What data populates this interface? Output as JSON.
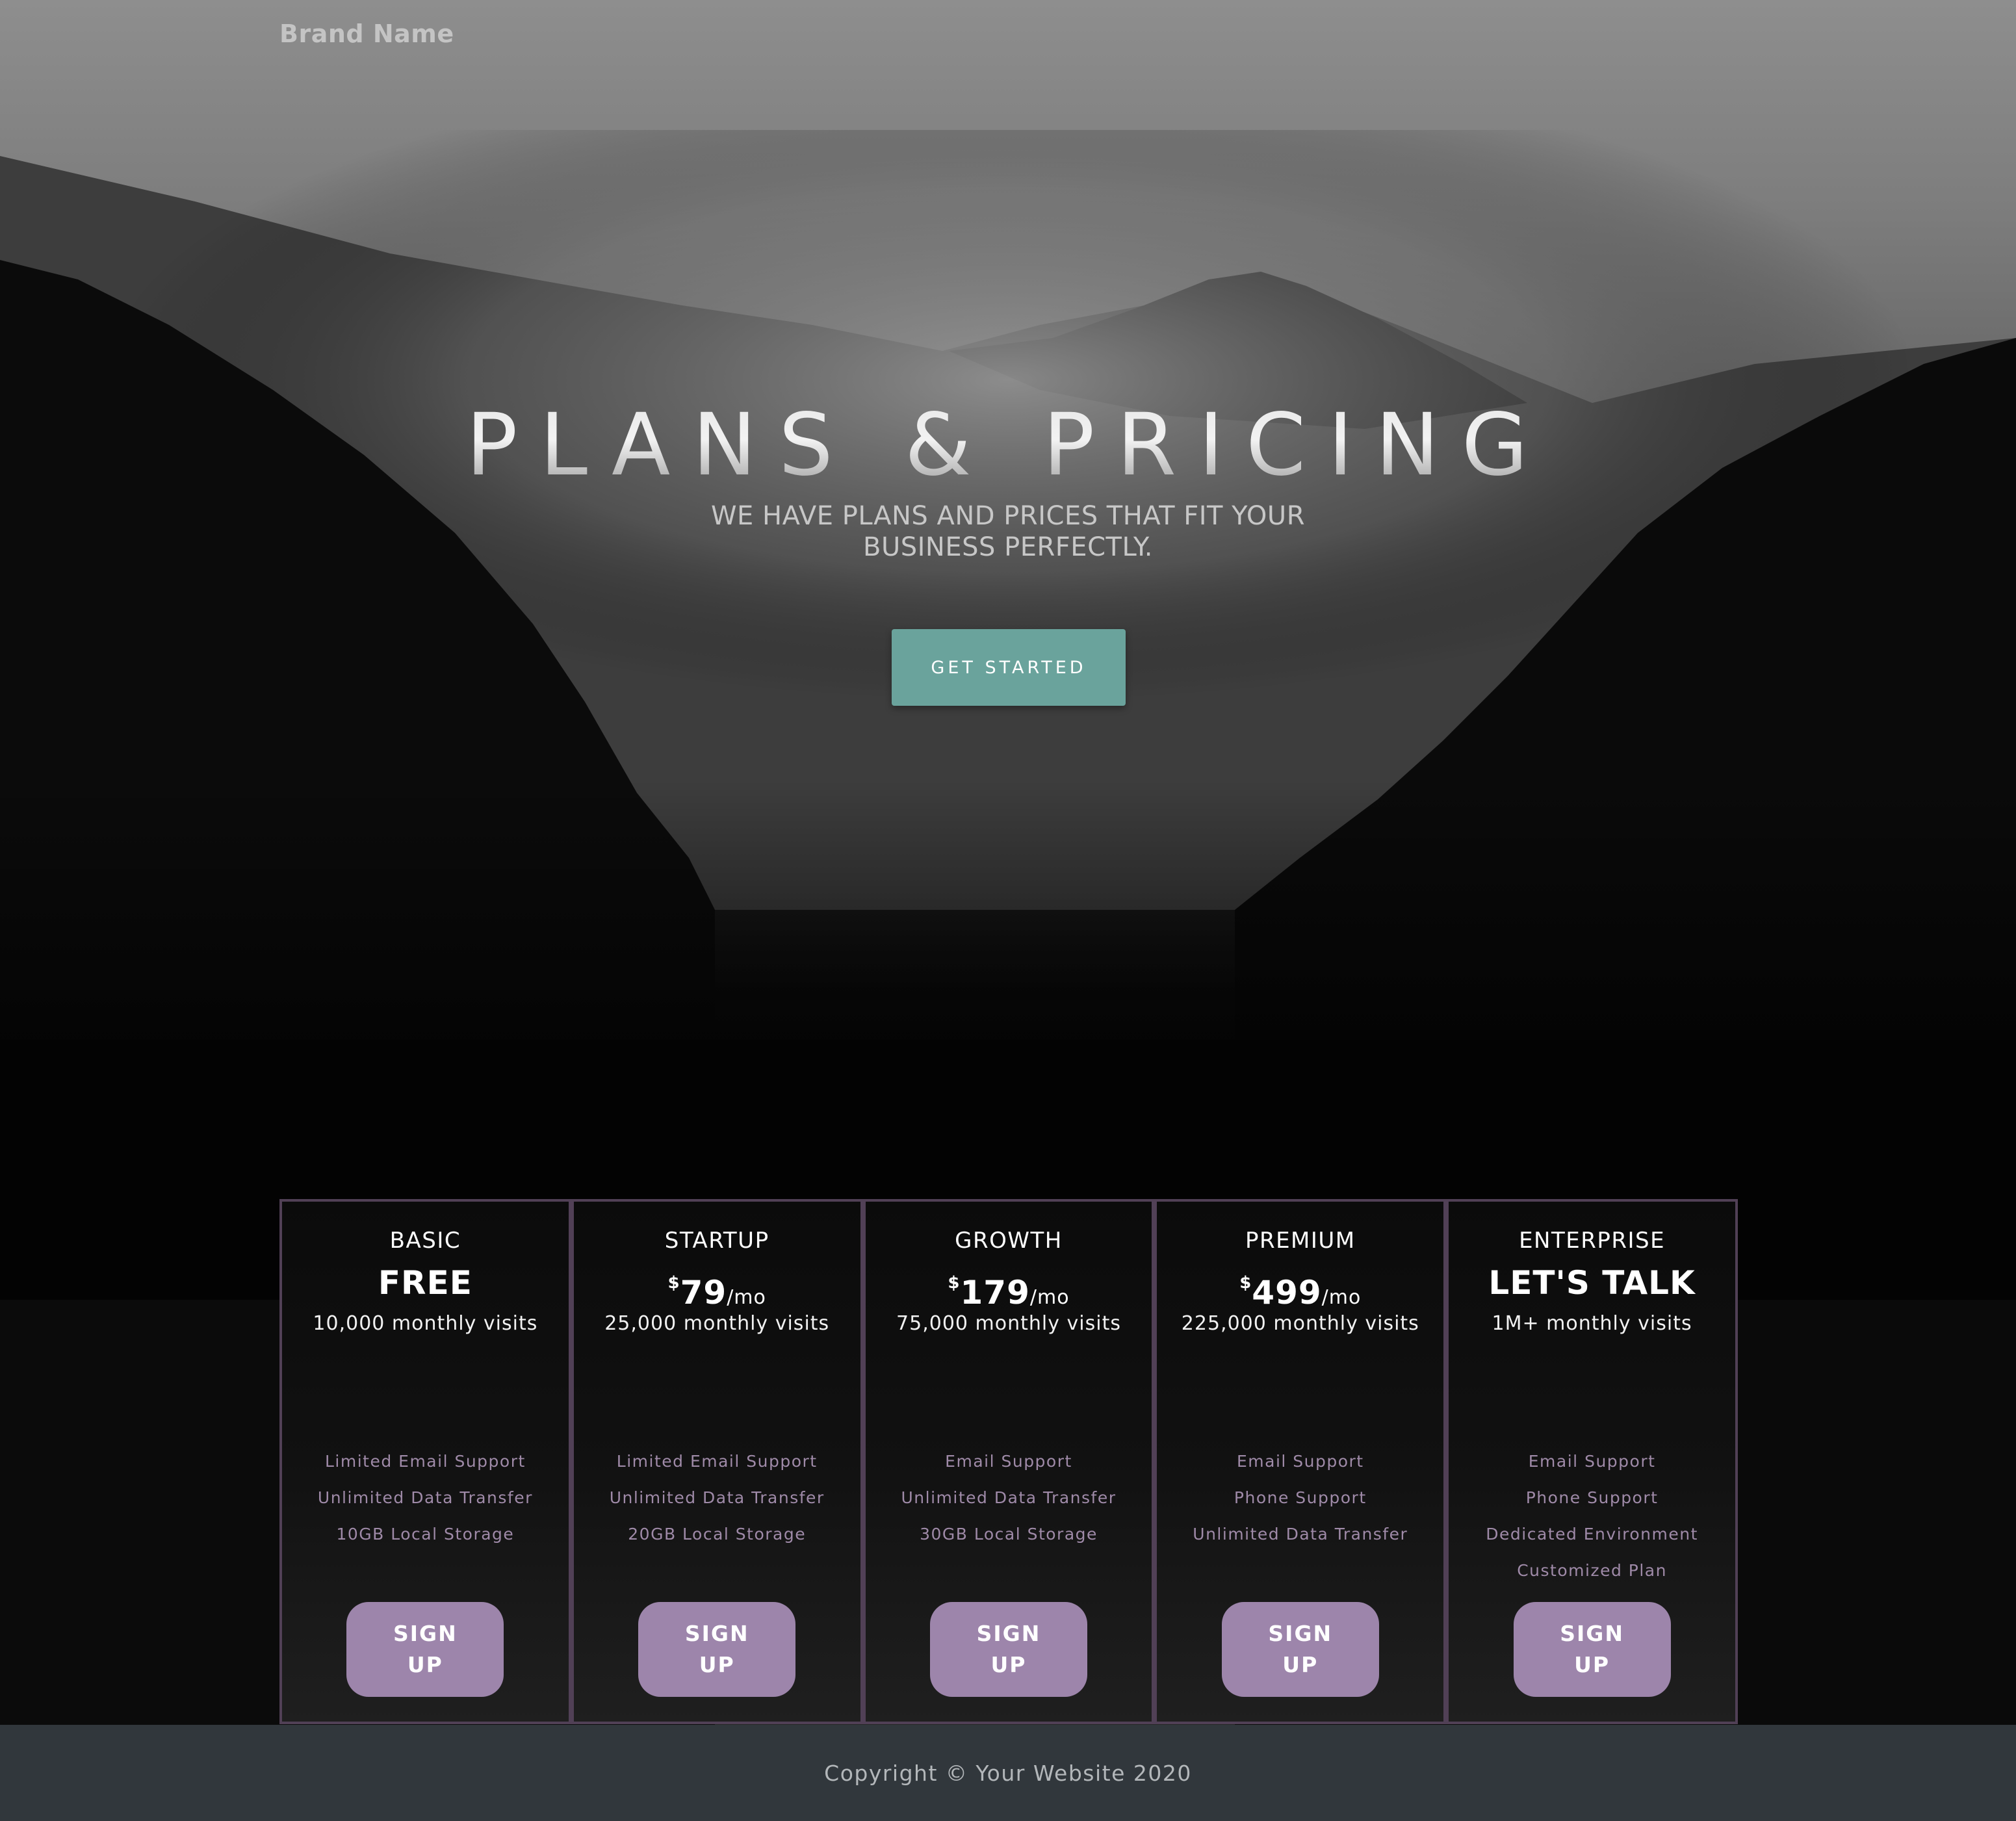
{
  "header": {
    "brand": "Brand Name"
  },
  "hero": {
    "title": "PLANS & PRICING",
    "subtitle": "WE HAVE PLANS AND PRICES THAT FIT YOUR BUSINESS PERFECTLY.",
    "cta_label": "GET STARTED",
    "cta_color": "#6aa39c"
  },
  "pricing": {
    "accent_color": "#9d85ab",
    "border_color": "#514056",
    "plans": [
      {
        "name": "BASIC",
        "price": "FREE",
        "currency": "",
        "period": "",
        "visits": "10,000 monthly visits",
        "features": [
          "Limited Email Support",
          "Unlimited Data Transfer",
          "10GB Local Storage"
        ],
        "button": "SIGN UP"
      },
      {
        "name": "STARTUP",
        "price": "79",
        "currency": "$",
        "period": "/mo",
        "visits": "25,000 monthly visits",
        "features": [
          "Limited Email Support",
          "Unlimited Data Transfer",
          "20GB Local Storage"
        ],
        "button": "SIGN UP"
      },
      {
        "name": "GROWTH",
        "price": "179",
        "currency": "$",
        "period": "/mo",
        "visits": "75,000 monthly visits",
        "features": [
          "Email Support",
          "Unlimited Data Transfer",
          "30GB Local Storage"
        ],
        "button": "SIGN UP"
      },
      {
        "name": "PREMIUM",
        "price": "499",
        "currency": "$",
        "period": "/mo",
        "visits": "225,000 monthly visits",
        "features": [
          "Email Support",
          "Phone Support",
          "Unlimited Data Transfer"
        ],
        "button": "SIGN UP"
      },
      {
        "name": "ENTERPRISE",
        "price": "LET'S TALK",
        "currency": "",
        "period": "",
        "visits": "1M+ monthly visits",
        "features": [
          "Email Support",
          "Phone Support",
          "Dedicated Environment",
          "Customized Plan"
        ],
        "button": "SIGN UP"
      }
    ]
  },
  "footer": {
    "copyright": "Copyright © Your Website 2020",
    "background_color": "#31373c"
  }
}
